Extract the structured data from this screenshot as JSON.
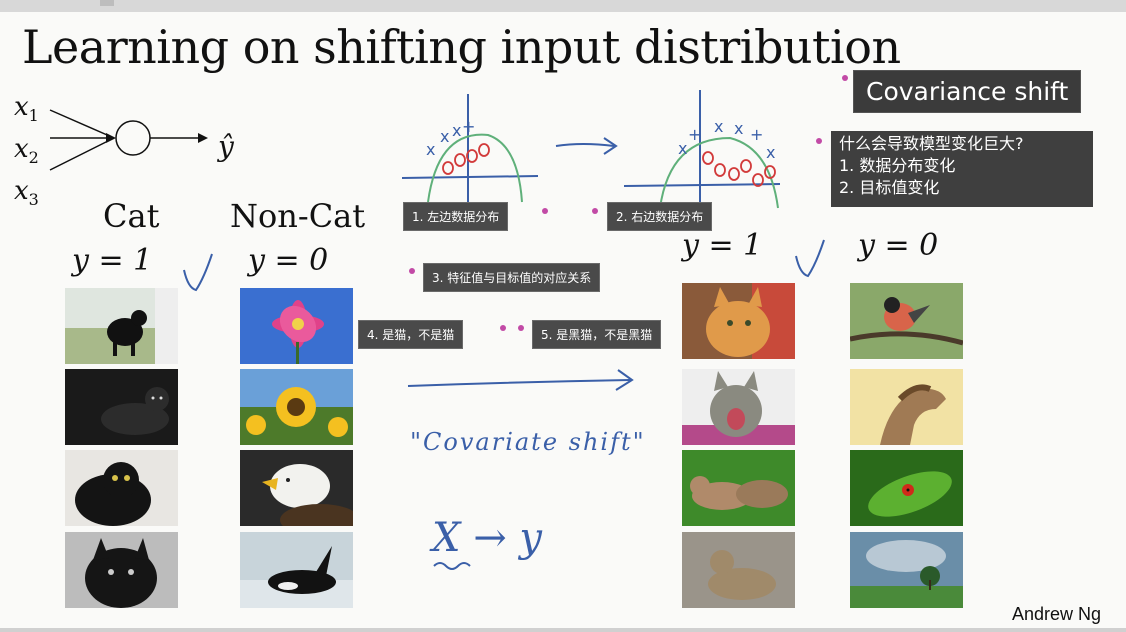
{
  "slide": {
    "title": "Learning on shifting input distribution",
    "credit": "Andrew Ng"
  },
  "neuron": {
    "inputs": [
      "x",
      "x",
      "x"
    ],
    "input_subs": [
      "1",
      "2",
      "3"
    ],
    "output": "ŷ"
  },
  "left_group": {
    "cat_label": "Cat",
    "noncat_label": "Non-Cat",
    "cat_y": "y = 1",
    "noncat_y": "y = 0"
  },
  "right_group": {
    "cat_y": "y = 1",
    "noncat_y": "y = 0"
  },
  "annotations": {
    "tag1": "1. 左边数据分布",
    "tag2": "2. 右边数据分布",
    "tag3": "3. 特征值与目标值的对应关系",
    "tag4": "4. 是猫，不是猫",
    "tag5": "5. 是黑猫，不是黑猫",
    "covariance_title": "Covariance shift",
    "question": "什么会导致模型变化巨大?",
    "answer1": "1. 数据分布变化",
    "answer2": "2. 目标值变化"
  },
  "handwriting": {
    "covariate": "\"Covariate shift\"",
    "x_to_y": "X → y"
  },
  "photos": {
    "left_cats": [
      "black-cat-grass",
      "black-cat-dark",
      "black-cat-yellow-eyes",
      "black-kitten"
    ],
    "left_noncats": [
      "pink-flower",
      "sunflower",
      "bald-eagle",
      "orca"
    ],
    "right_cats": [
      "orange-cat",
      "tabby-cat-yawning",
      "cats-on-grass",
      "tabby-cat-gravel"
    ],
    "right_noncats": [
      "bird-on-branch",
      "horse",
      "ladybug-leaf",
      "tree-landscape"
    ]
  },
  "colors": {
    "tag_bg": "#4a4a4a",
    "dot": "#c24aa6",
    "ink_blue": "#3a5fa8",
    "ink_red": "#d23b3b",
    "ink_green": "#5fb07a"
  }
}
